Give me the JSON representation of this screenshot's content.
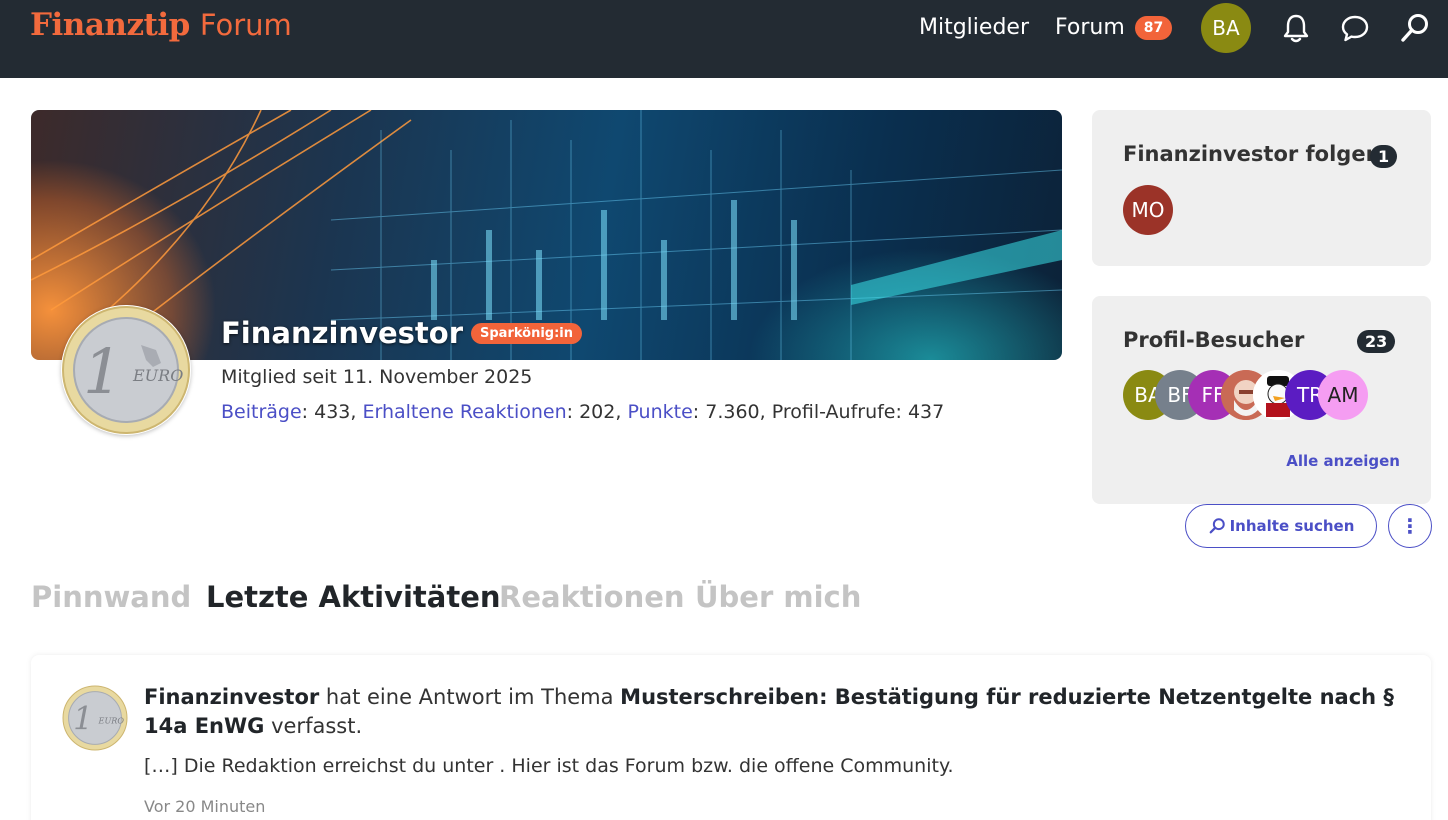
{
  "header": {
    "brand": "Finanztip",
    "brand_suffix": "Forum",
    "nav_members": "Mitglieder",
    "nav_forum": "Forum",
    "forum_badge": "87",
    "user_initials": "BA",
    "icons": [
      "bell-icon",
      "chat-icon",
      "search-icon"
    ]
  },
  "profile": {
    "username": "Finanzinvestor",
    "rank": "Sparkönig:in",
    "member_since": "Mitglied seit 11. November 2025",
    "stats": {
      "posts_label": "Beiträge",
      "posts_value": ": 433, ",
      "reactions_label": "Erhaltene Reaktionen",
      "reactions_value": ": 202, ",
      "points_label": "Punkte",
      "points_value": ": 7.360, Profil-Aufrufe: 437"
    },
    "avatar_text": "EURO",
    "avatar_number": "1"
  },
  "sidebar": {
    "follow": {
      "title": "Finanzinvestor folgen",
      "count": "1",
      "followers": [
        {
          "initials": "MO",
          "color": "#9b3328"
        }
      ]
    },
    "visitors": {
      "title": "Profil-Besucher",
      "count": "23",
      "list": [
        {
          "initials": "BA",
          "color": "#8a8a12"
        },
        {
          "initials": "BF",
          "color": "#76808c"
        },
        {
          "initials": "FF",
          "color": "#a52fb5"
        },
        {
          "initials": "",
          "color": "#d9725d"
        },
        {
          "initials": "",
          "color": "#ffffff"
        },
        {
          "initials": "TR",
          "color": "#5b1cc2"
        },
        {
          "initials": "AM",
          "color": "#f59df2"
        }
      ],
      "show_all": "Alle anzeigen"
    },
    "search_button": "Inhalte suchen",
    "more_button": "⋮"
  },
  "tabs": {
    "wall": "Pinnwand",
    "activity": "Letzte Aktivitäten",
    "reactions": "Reaktionen",
    "about": "Über mich"
  },
  "activity": {
    "author": "Finanzinvestor",
    "action": " hat eine Antwort im Thema ",
    "thread": "Musterschreiben: Bestätigung für reduzierte Netzentgelte nach § 14a EnWG",
    "suffix": " verfasst.",
    "snippet": "[…] Die Redaktion erreichst du unter . Hier ist das Forum bzw. die offene Community.",
    "time": "Vor 20 Minuten"
  },
  "colors": {
    "header_bg": "#232b33",
    "brand": "#f26a3d",
    "link": "#4b4fc6",
    "badge": "#f2643a"
  }
}
